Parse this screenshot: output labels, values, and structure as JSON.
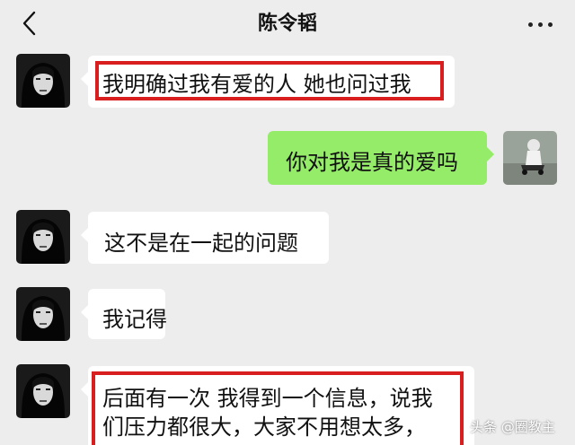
{
  "header": {
    "title": "陈令韬"
  },
  "messages": [
    {
      "side": "left",
      "text": "我明确过我有爱的人 她也问过我",
      "highlighted": true
    },
    {
      "side": "right",
      "text": "你对我是真的爱吗",
      "highlighted": false
    },
    {
      "side": "left",
      "text": "这不是在一起的问题",
      "highlighted": false
    },
    {
      "side": "left",
      "text": "我记得",
      "highlighted": false
    },
    {
      "side": "left",
      "lines": [
        "后面有一次 我得到一个信息，说我",
        "们压力都很大，大家不用想太多，"
      ],
      "highlighted": true
    }
  ],
  "watermark": "头条 @圈教主",
  "colors": {
    "background": "#ededed",
    "bubble_left": "#ffffff",
    "bubble_right": "#95ec69",
    "highlight": "#d81e1e"
  }
}
